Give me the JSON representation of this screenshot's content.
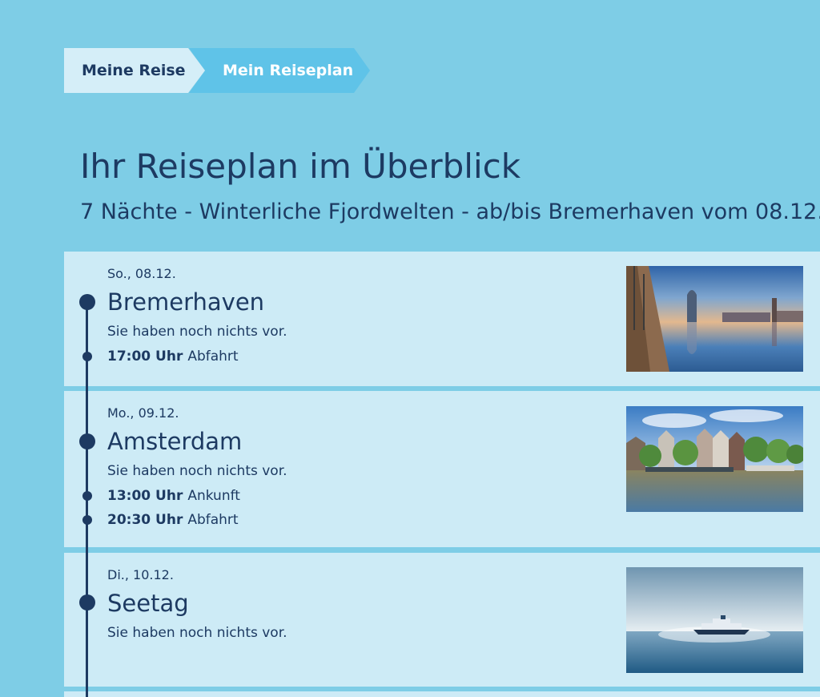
{
  "breadcrumb": {
    "items": [
      {
        "label": "Meine Reise"
      },
      {
        "label": "Mein Reiseplan"
      }
    ]
  },
  "page": {
    "title": "Ihr Reiseplan im Überblick",
    "subtitle": "7 Nächte - Winterliche Fjordwelten - ab/bis Bremerhaven vom 08.12."
  },
  "days": [
    {
      "date": "So., 08.12.",
      "port": "Bremerhaven",
      "note": "Sie haben noch nichts vor.",
      "events": [
        {
          "time": "17:00 Uhr",
          "label": "Abfahrt"
        }
      ],
      "image": "harbor-photo"
    },
    {
      "date": "Mo., 09.12.",
      "port": "Amsterdam",
      "note": "Sie haben noch nichts vor.",
      "events": [
        {
          "time": "13:00 Uhr",
          "label": "Ankunft"
        },
        {
          "time": "20:30 Uhr",
          "label": "Abfahrt"
        }
      ],
      "image": "canal-houses-photo"
    },
    {
      "date": "Di., 10.12.",
      "port": "Seetag",
      "note": "Sie haben noch nichts vor.",
      "events": [],
      "image": "ship-at-sea-photo"
    }
  ],
  "colors": {
    "background": "#7ecde6",
    "card": "#cdebf6",
    "text": "#1d3a62",
    "crumb_active": "#5fc3e8",
    "crumb_inactive": "#d5eef8"
  }
}
